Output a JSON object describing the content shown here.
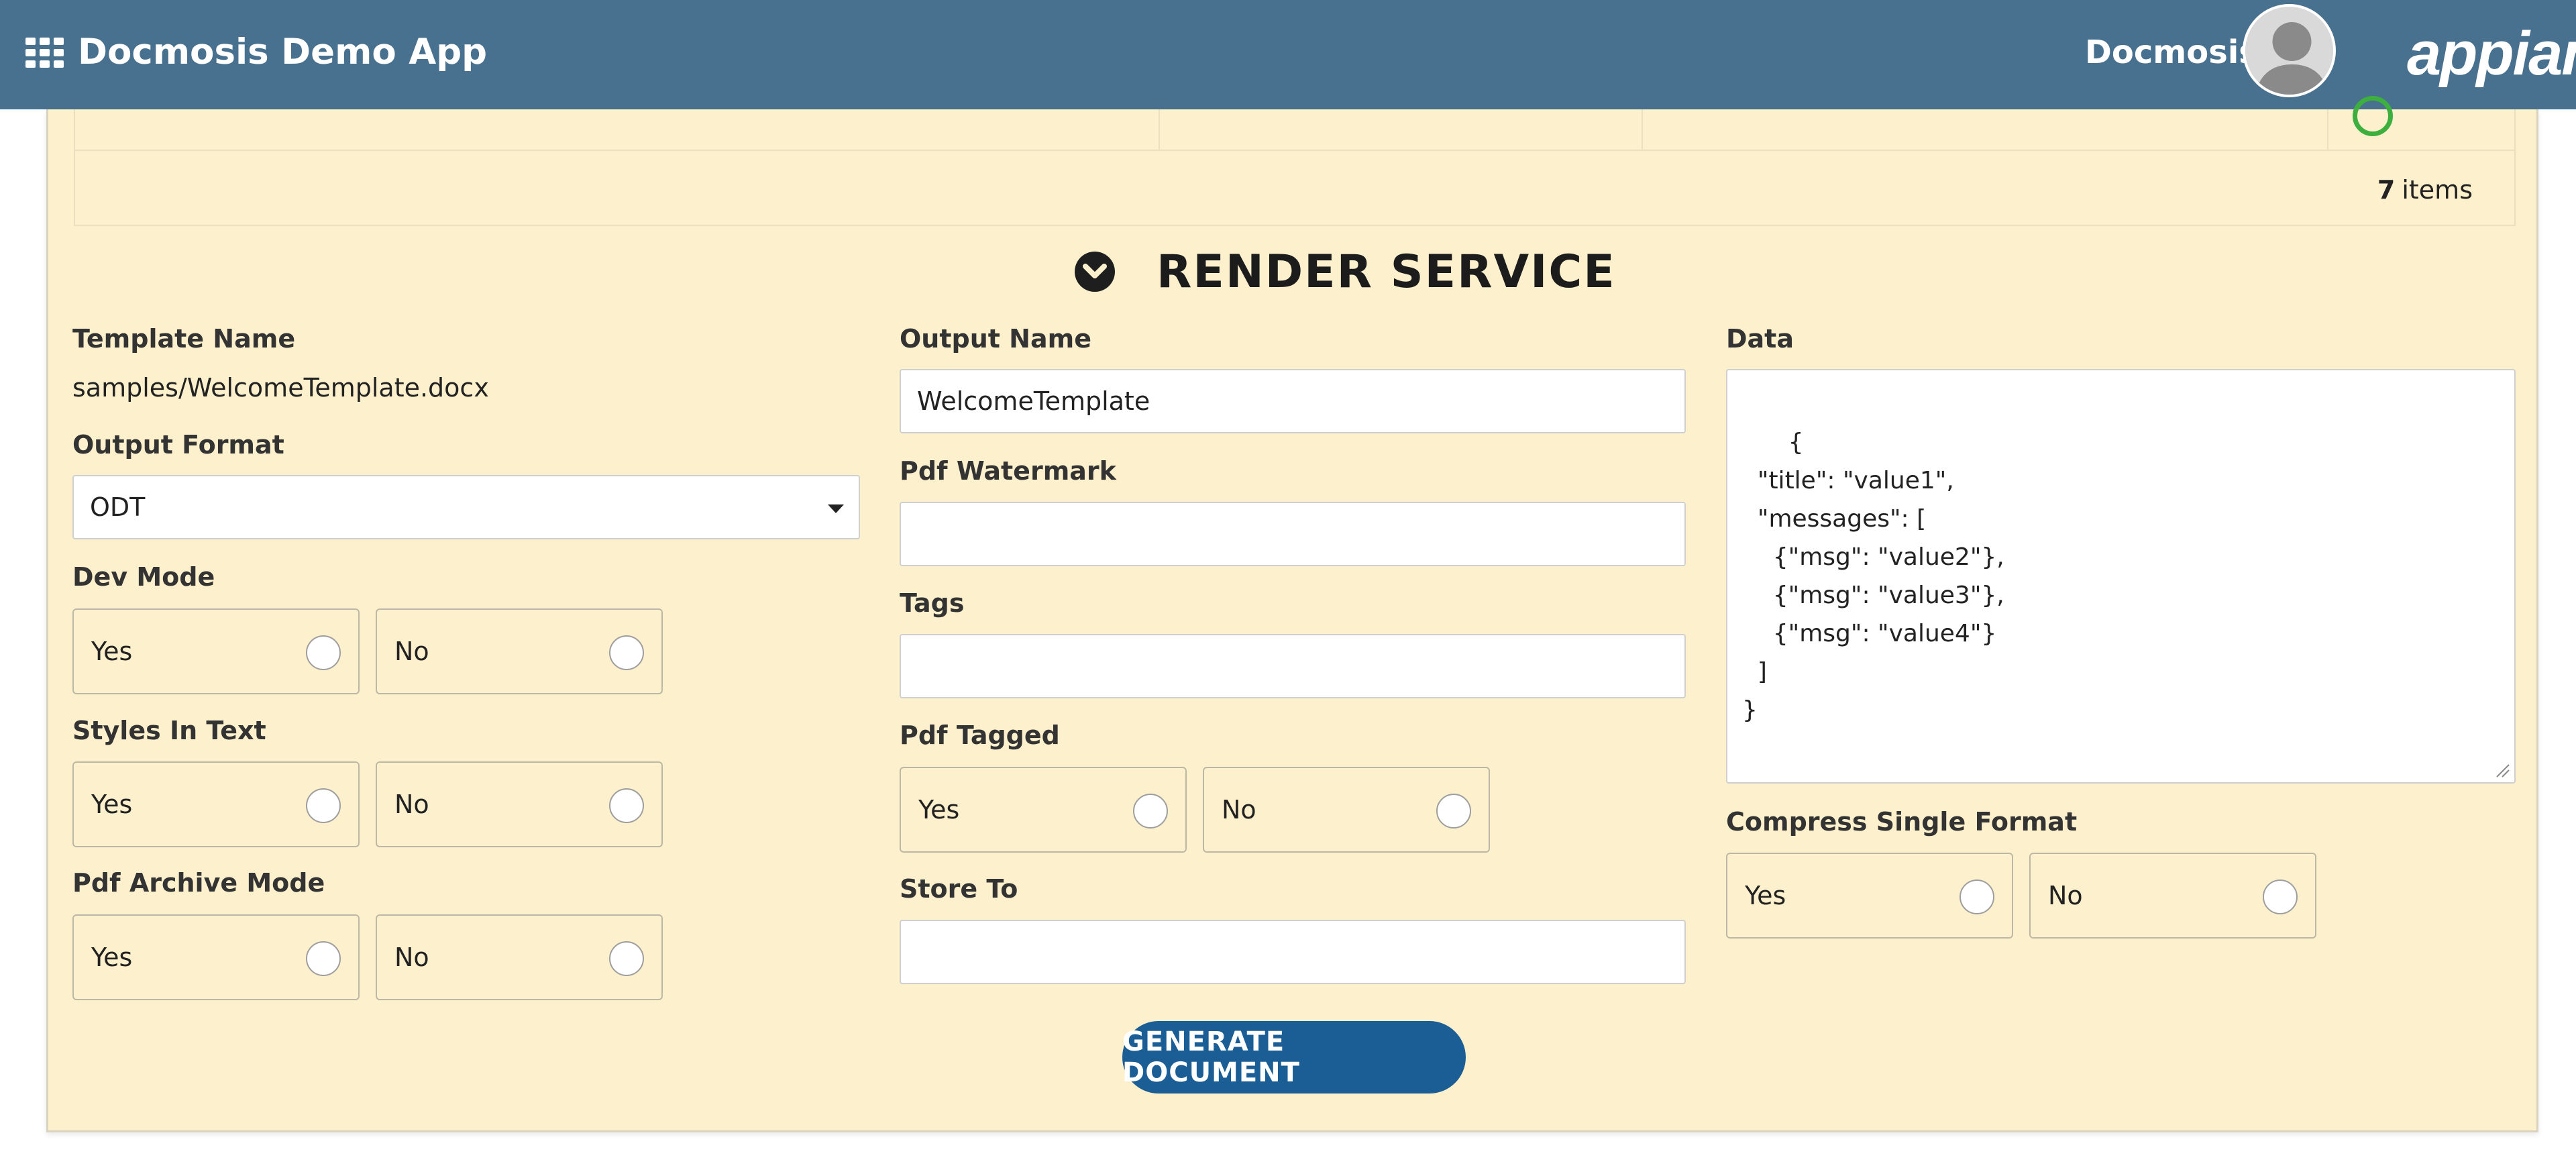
{
  "header": {
    "app_title": "Docmosis Demo App",
    "user_name": "Docmosis",
    "brand": "appian",
    "color": "#48708f"
  },
  "grid": {
    "item_count": "7",
    "items_label": "items"
  },
  "section": {
    "title": "RENDER SERVICE"
  },
  "left": {
    "template_name_label": "Template Name",
    "template_name_value": "samples/WelcomeTemplate.docx",
    "output_format_label": "Output Format",
    "output_format_value": "ODT",
    "dev_mode_label": "Dev Mode",
    "styles_in_text_label": "Styles In Text",
    "pdf_archive_mode_label": "Pdf Archive Mode"
  },
  "middle": {
    "output_name_label": "Output Name",
    "output_name_value": "WelcomeTemplate",
    "pdf_watermark_label": "Pdf Watermark",
    "pdf_watermark_value": "",
    "tags_label": "Tags",
    "tags_value": "",
    "pdf_tagged_label": "Pdf Tagged",
    "store_to_label": "Store To",
    "store_to_value": ""
  },
  "right": {
    "data_label": "Data",
    "data_value": "{\n  \"title\": \"value1\",\n  \"messages\": [\n    {\"msg\": \"value2\"},\n    {\"msg\": \"value3\"},\n    {\"msg\": \"value4\"}\n  ]\n}",
    "compress_single_format_label": "Compress Single Format"
  },
  "options": {
    "yes": "Yes",
    "no": "No"
  },
  "actions": {
    "generate_label": "GENERATE DOCUMENT",
    "button_color": "#1b5d95"
  },
  "theme": {
    "panel_background": "#fdf0cc"
  }
}
